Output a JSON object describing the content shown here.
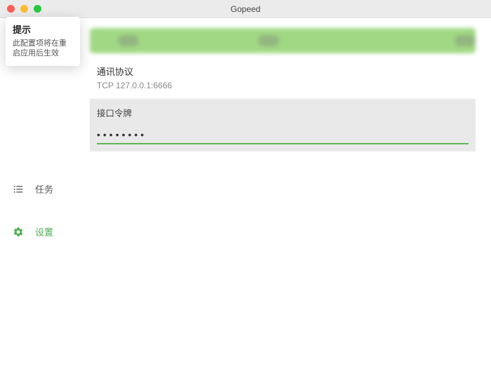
{
  "window": {
    "title": "Gopeed"
  },
  "toast": {
    "title": "提示",
    "body": "此配置项将在重启应用后生效"
  },
  "sidebar": {
    "items": [
      {
        "label": "任务"
      },
      {
        "label": "设置"
      }
    ]
  },
  "settings": {
    "protocol": {
      "label": "通讯协议",
      "value": "TCP 127.0.0.1:6666"
    },
    "token": {
      "label": "接口令牌",
      "value": "••••••••"
    }
  }
}
